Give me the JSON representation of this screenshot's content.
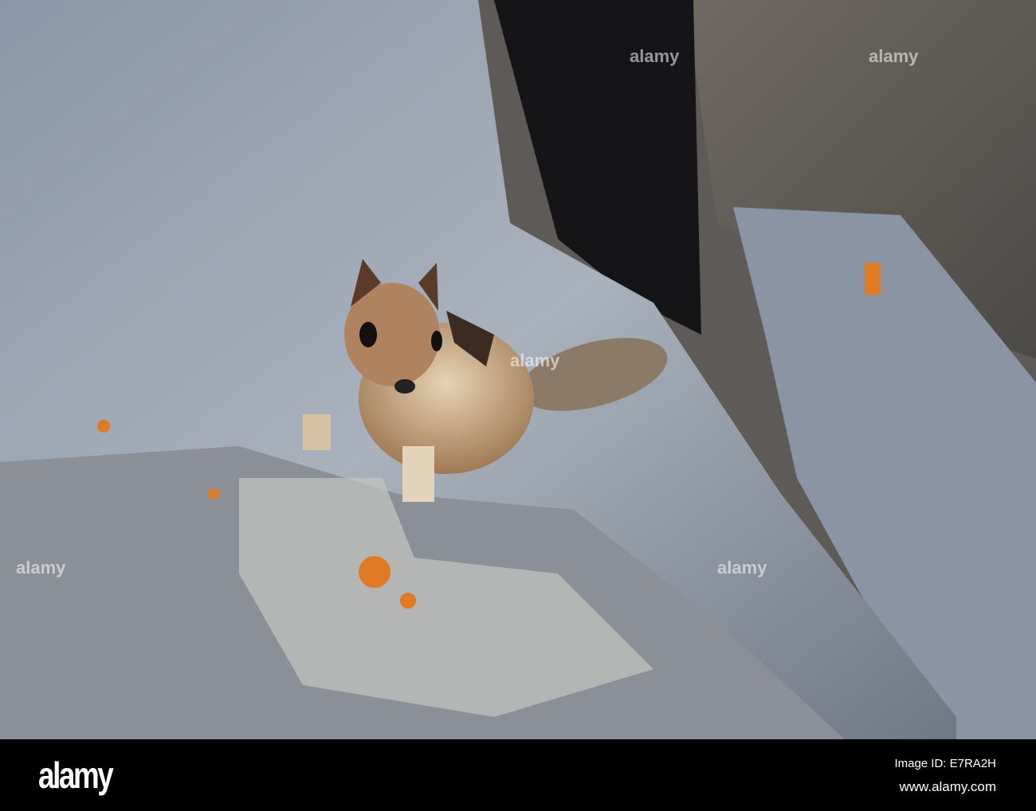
{
  "photo": {
    "subject": "chipmunk-on-rocks"
  },
  "watermark": {
    "text": "alamy"
  },
  "footer": {
    "logo": "alamy",
    "image_id": "Image ID: E7RA2H",
    "url": "www.alamy.com"
  }
}
